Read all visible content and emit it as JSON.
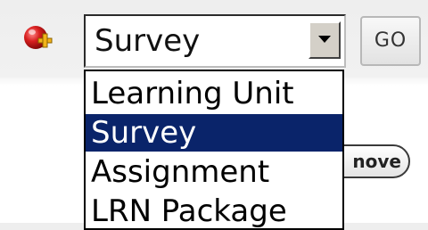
{
  "toolbar": {
    "add_icon": "add-plus-icon",
    "content_type_select": {
      "value": "Survey"
    },
    "go_label": "GO",
    "remove_label": "nove"
  },
  "dropdown": {
    "options": [
      {
        "label": "Learning Unit",
        "selected": false
      },
      {
        "label": "Survey",
        "selected": true
      },
      {
        "label": "Assignment",
        "selected": false
      },
      {
        "label": "LRN Package",
        "selected": false
      }
    ]
  },
  "colors": {
    "selection_highlight": "#0a246a",
    "icon_red": "#d81f1f",
    "icon_plus": "#f2b319"
  }
}
